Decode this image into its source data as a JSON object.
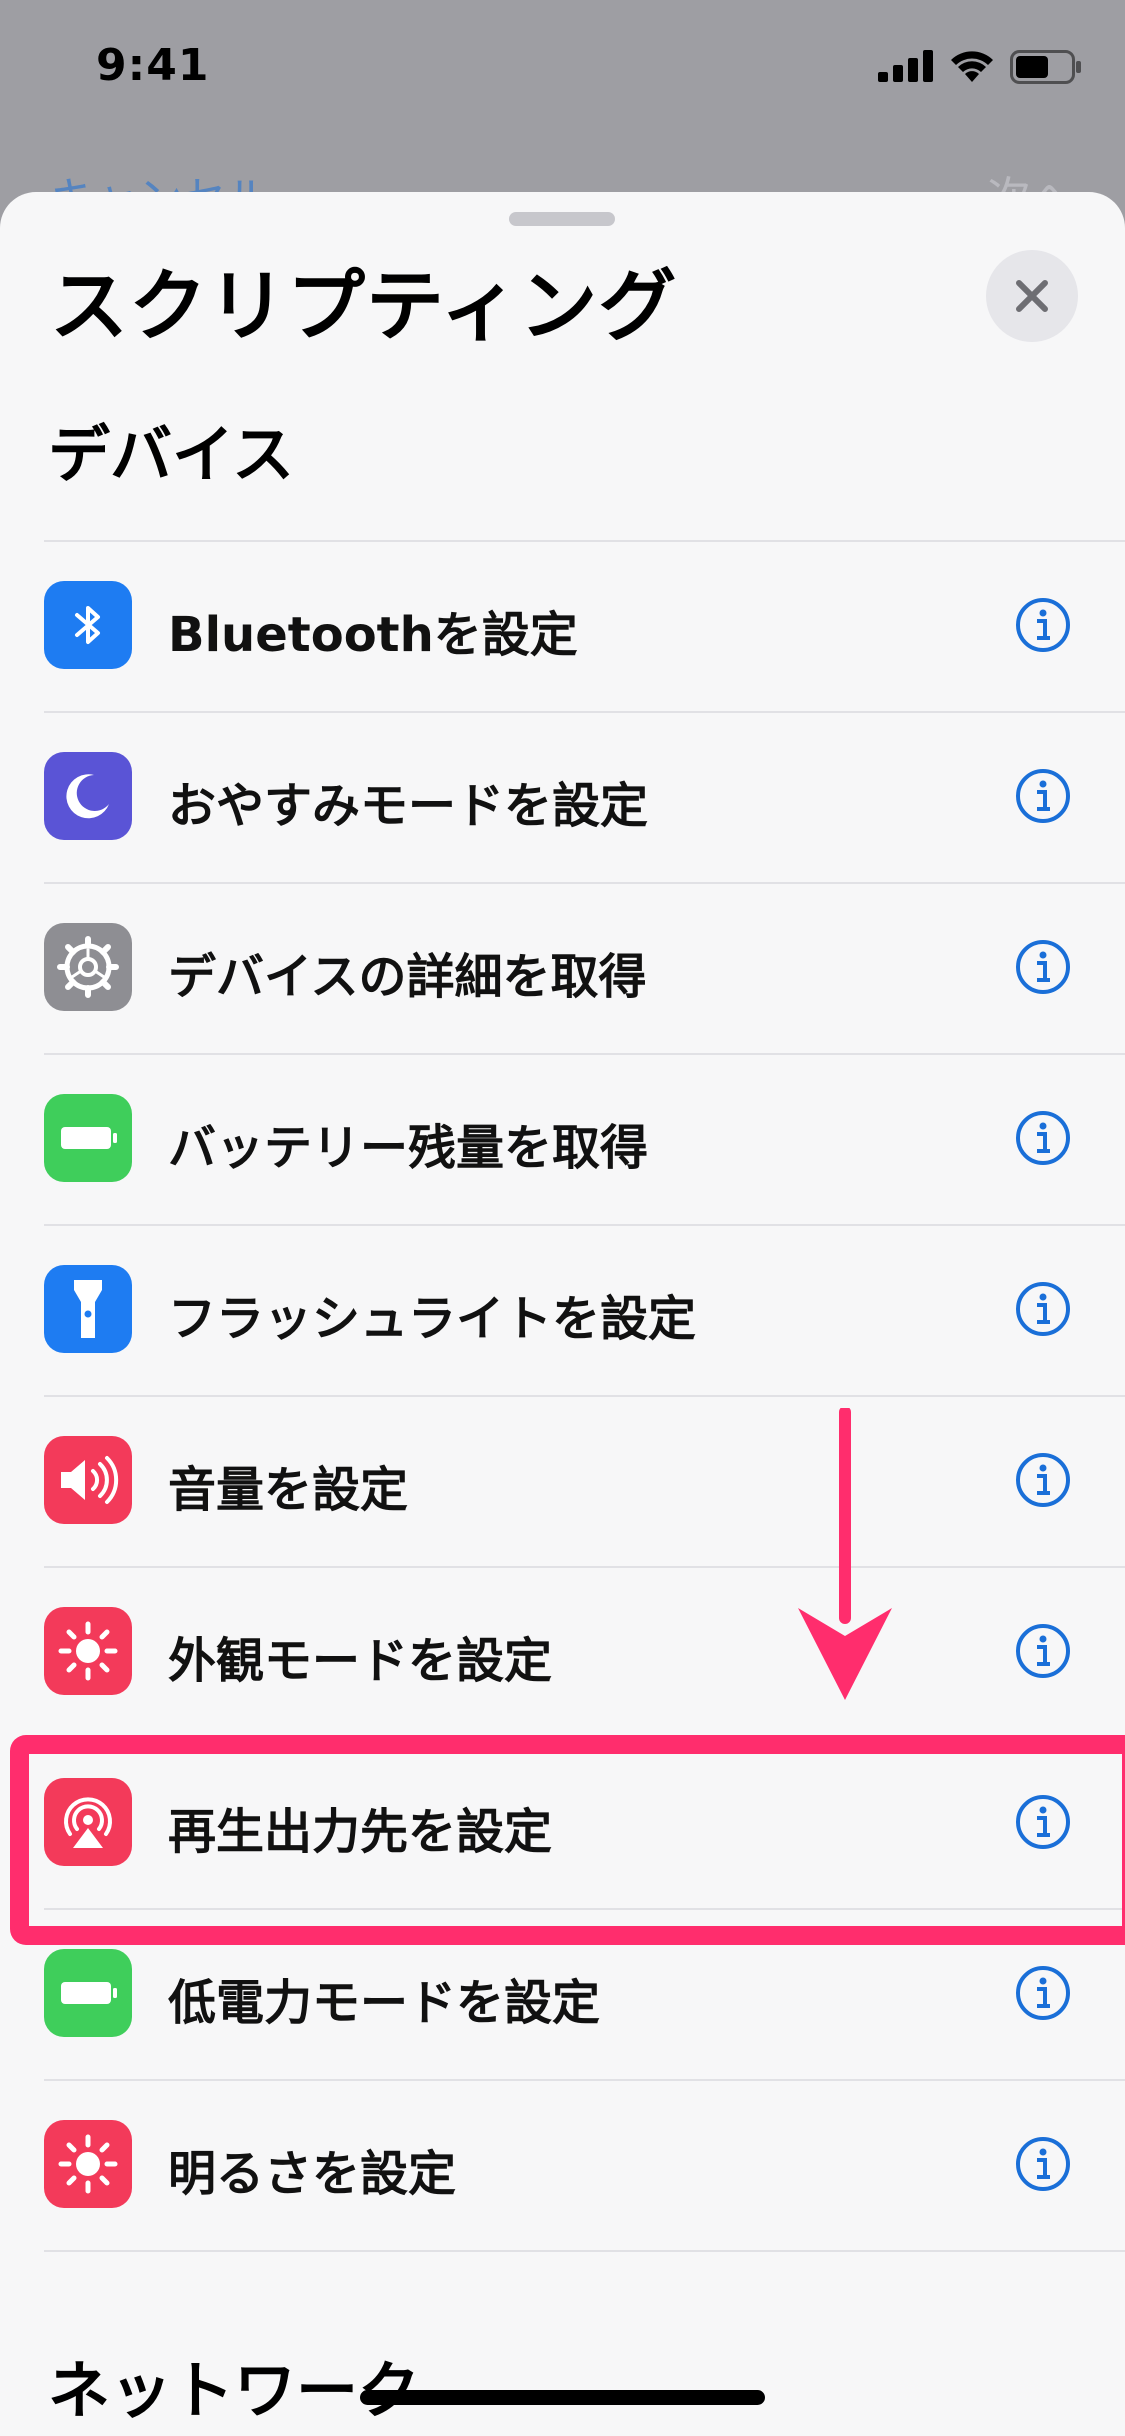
{
  "status": {
    "time": "9:41"
  },
  "behind_nav": {
    "cancel": "キャンセル",
    "next": "次へ"
  },
  "sheet": {
    "title": "スクリプティング",
    "close_icon": "close-icon"
  },
  "sections": {
    "devices": "デバイス",
    "network": "ネットワーク"
  },
  "actions": [
    {
      "label": "Bluetoothを設定",
      "icon": "bluetooth-icon",
      "color": "#1e7cf2"
    },
    {
      "label": "おやすみモードを設定",
      "icon": "moon-icon",
      "color": "#5a54d6"
    },
    {
      "label": "デバイスの詳細を取得",
      "icon": "gear-icon",
      "color": "#8e8e93"
    },
    {
      "label": "バッテリー残量を取得",
      "icon": "battery-icon",
      "color": "#3fce5b"
    },
    {
      "label": "フラッシュライトを設定",
      "icon": "flashlight-icon",
      "color": "#1e7cf2"
    },
    {
      "label": "音量を設定",
      "icon": "speaker-icon",
      "color": "#f33a5a"
    },
    {
      "label": "外観モードを設定",
      "icon": "sun-icon",
      "color": "#f33a5a"
    },
    {
      "label": "再生出力先を設定",
      "icon": "airplay-audio-icon",
      "color": "#f33a5a"
    },
    {
      "label": "低電力モードを設定",
      "icon": "battery-icon",
      "color": "#3fce5b"
    },
    {
      "label": "明るさを設定",
      "icon": "sun-icon",
      "color": "#f33a5a"
    }
  ],
  "colors": {
    "accent": "#1a6fd8",
    "highlight": "#ff2d6d"
  }
}
